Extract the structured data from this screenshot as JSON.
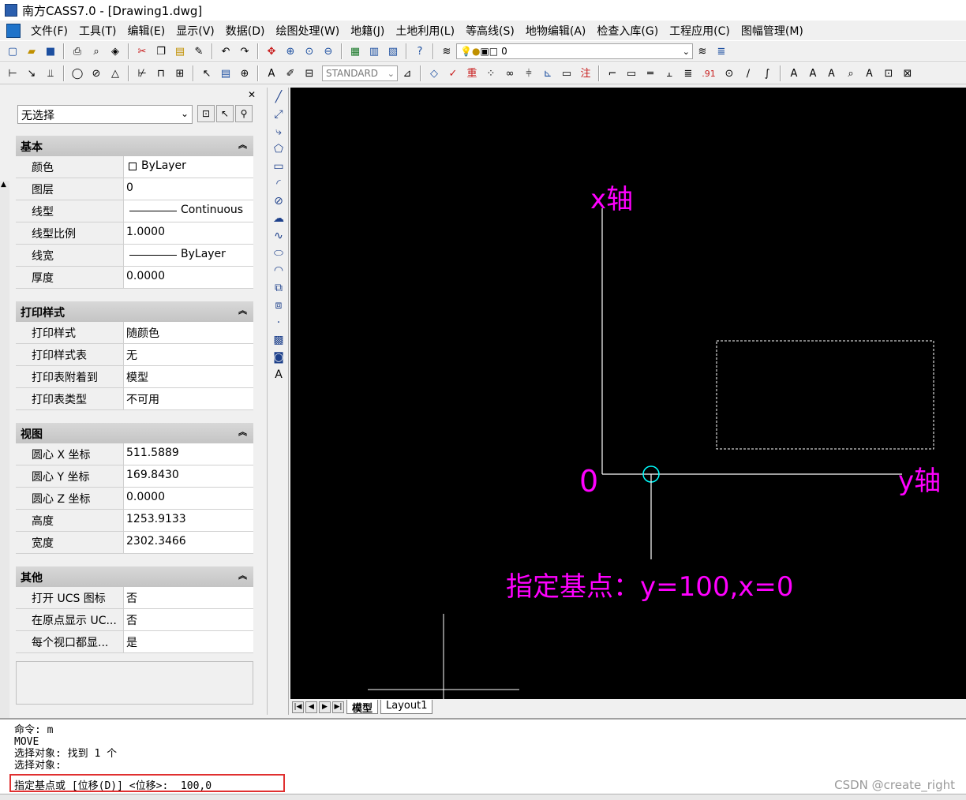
{
  "window": {
    "title": "南方CASS7.0 - [Drawing1.dwg]"
  },
  "menu": [
    "文件(F)",
    "工具(T)",
    "编辑(E)",
    "显示(V)",
    "数据(D)",
    "绘图处理(W)",
    "地籍(J)",
    "土地利用(L)",
    "等高线(S)",
    "地物编辑(A)",
    "检查入库(G)",
    "工程应用(C)",
    "图幅管理(M)"
  ],
  "toolbar": {
    "layer_value": "0",
    "text_style": "STANDARD",
    "label_zhong": "重",
    "label_zhu": "注",
    "label_91": ".91"
  },
  "properties": {
    "selection": "无选择",
    "sections": [
      {
        "title": "基本",
        "rows": [
          {
            "key": "颜色",
            "value": "ByLayer",
            "swatch": "square"
          },
          {
            "key": "图层",
            "value": "0"
          },
          {
            "key": "线型",
            "value": "Continuous",
            "swatch": "line"
          },
          {
            "key": "线型比例",
            "value": "1.0000"
          },
          {
            "key": "线宽",
            "value": "ByLayer",
            "swatch": "line"
          },
          {
            "key": "厚度",
            "value": "0.0000"
          }
        ]
      },
      {
        "title": "打印样式",
        "rows": [
          {
            "key": "打印样式",
            "value": "随颜色"
          },
          {
            "key": "打印样式表",
            "value": "无"
          },
          {
            "key": "打印表附着到",
            "value": "模型"
          },
          {
            "key": "打印表类型",
            "value": "不可用"
          }
        ]
      },
      {
        "title": "视图",
        "rows": [
          {
            "key": "圆心 X 坐标",
            "value": "511.5889"
          },
          {
            "key": "圆心 Y 坐标",
            "value": "169.8430"
          },
          {
            "key": "圆心 Z 坐标",
            "value": "0.0000"
          },
          {
            "key": "高度",
            "value": "1253.9133"
          },
          {
            "key": "宽度",
            "value": "2302.3466"
          }
        ]
      },
      {
        "title": "其他",
        "rows": [
          {
            "key": "打开 UCS 图标",
            "value": "否"
          },
          {
            "key": "在原点显示 UC...",
            "value": "否"
          },
          {
            "key": "每个视口都显...",
            "value": "是"
          }
        ]
      }
    ]
  },
  "canvas": {
    "x_axis_label": "x轴",
    "y_axis_label": "y轴",
    "origin_label": "0",
    "annotation": "指定基点：y=100,x=0",
    "colors": {
      "background": "#000000",
      "annotation": "#ff00ff",
      "marker": "#00ffff",
      "lines": "#ffffff"
    }
  },
  "tabs": [
    "模型",
    "Layout1"
  ],
  "command": {
    "history": [
      "命令: m",
      "MOVE",
      "选择对象: 找到 1 个",
      "选择对象:"
    ],
    "prompt": "指定基点或 [位移(D)] <位移>:  100,0"
  },
  "watermark": "CSDN @create_right"
}
